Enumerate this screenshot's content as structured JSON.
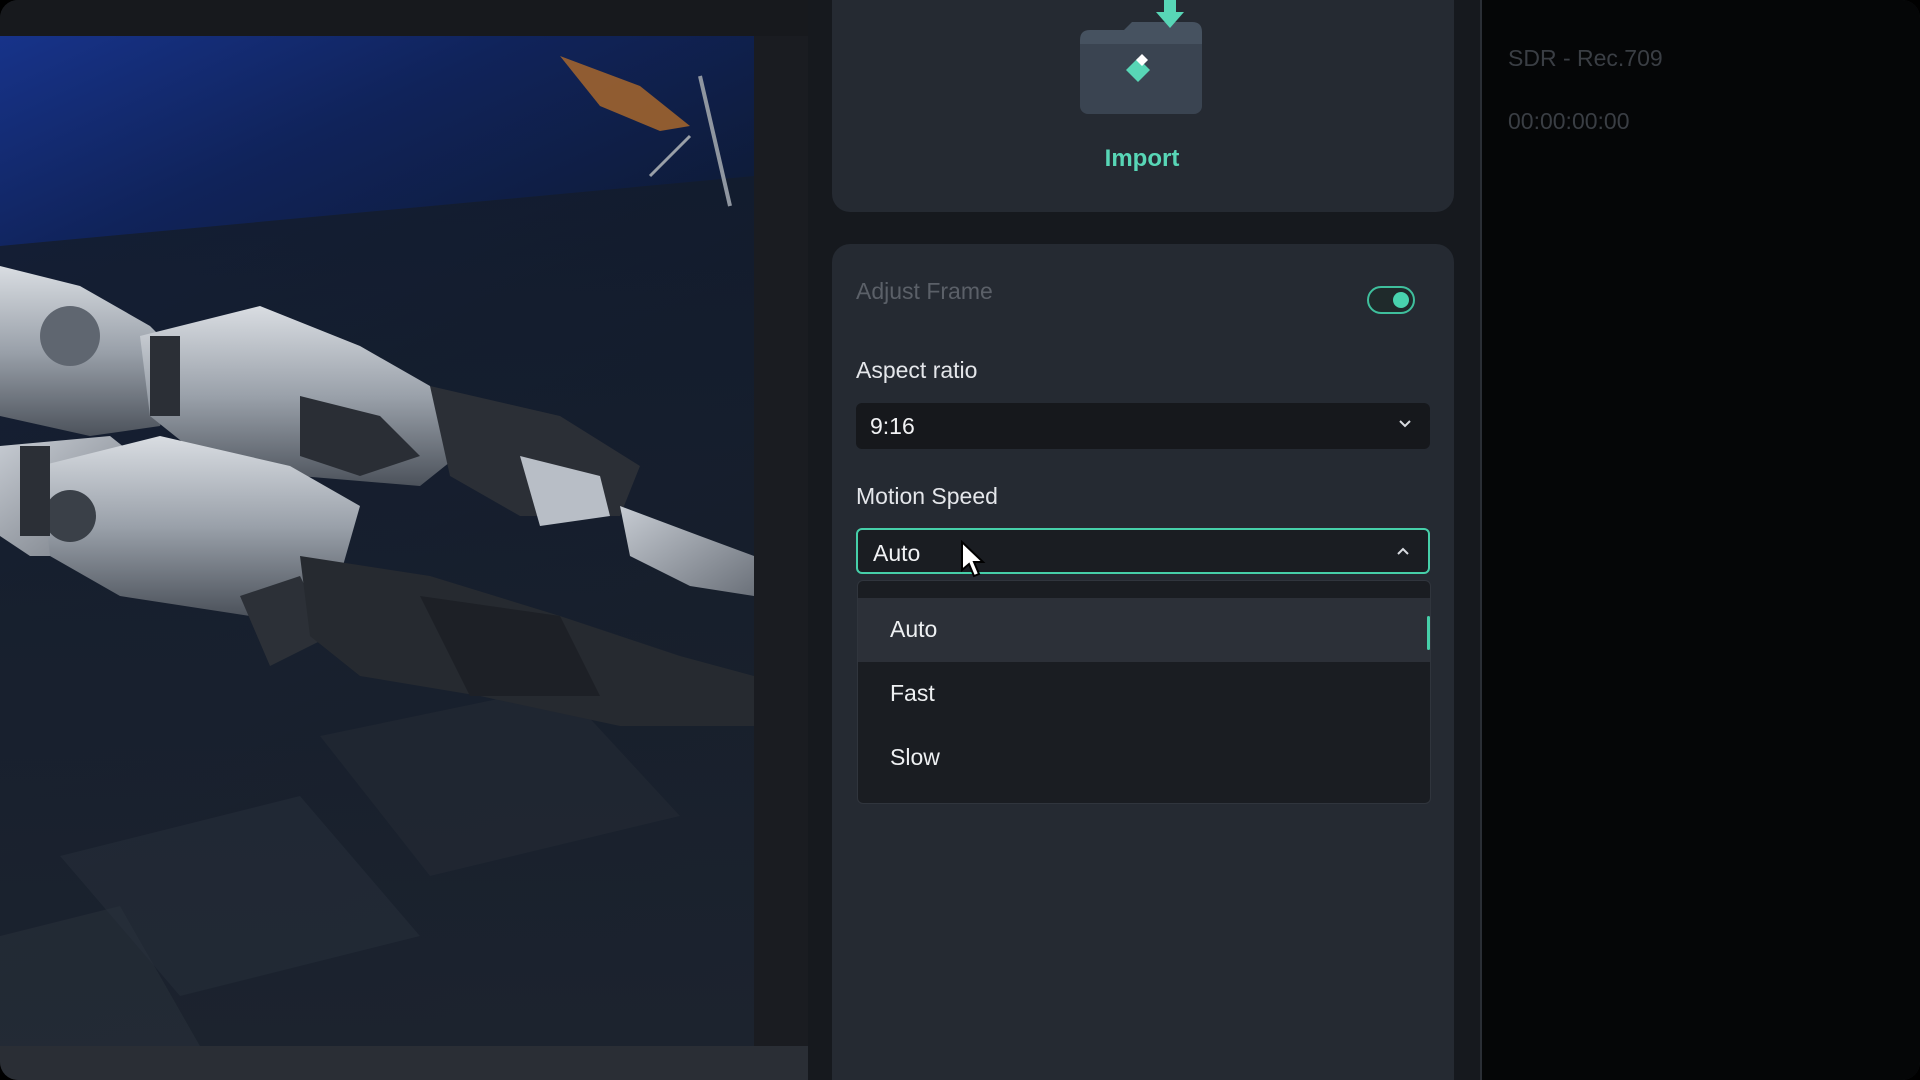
{
  "import": {
    "label": "Import",
    "icon": "folder-import-icon"
  },
  "adjust_frame": {
    "title": "Adjust Frame",
    "toggle_on": true,
    "aspect_ratio": {
      "label": "Aspect ratio",
      "value": "9:16"
    },
    "motion_speed": {
      "label": "Motion Speed",
      "value": "Auto",
      "open": true,
      "options": [
        "Auto",
        "Fast",
        "Slow"
      ],
      "selected_index": 0
    }
  },
  "info": {
    "color_space": "SDR - Rec.709",
    "timecode": "00:00:00:00"
  },
  "colors": {
    "accent": "#46cfa9",
    "panel": "#252a32",
    "background": "#16191e"
  }
}
